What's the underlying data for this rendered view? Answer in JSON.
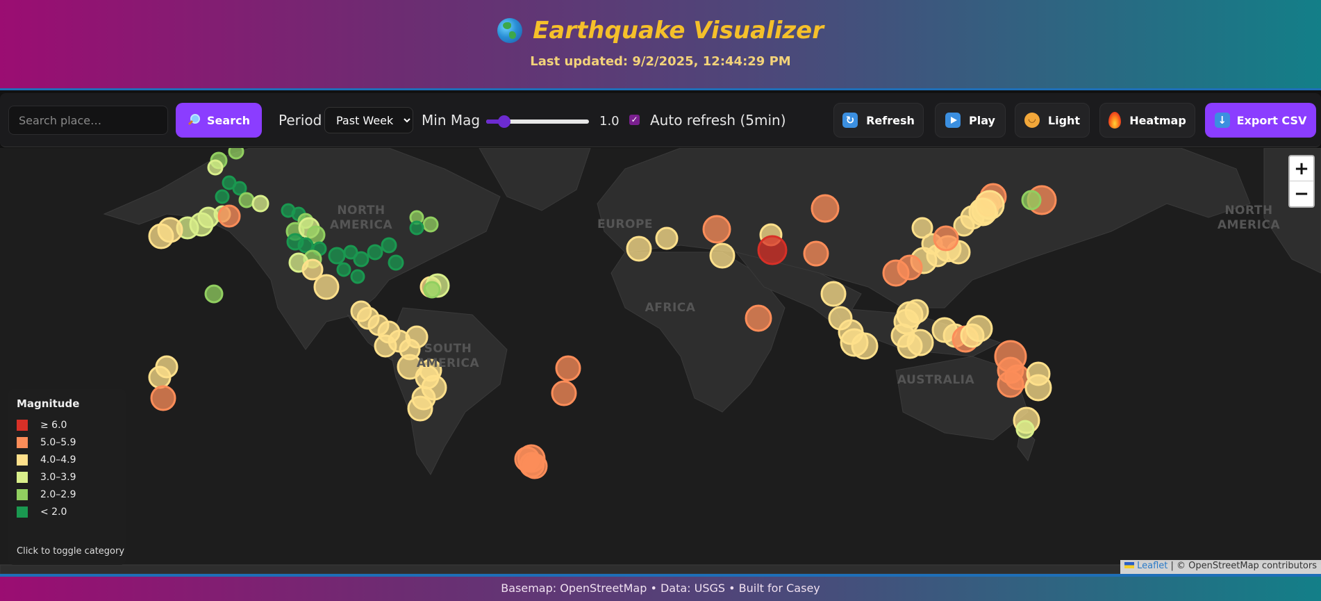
{
  "header": {
    "title": "Earthquake Visualizer",
    "updated": "Last updated: 9/2/2025, 12:44:29 PM"
  },
  "toolbar": {
    "search_placeholder": "Search place…",
    "search_label": "Search",
    "period_label": "Period",
    "period_selected": "Past Week",
    "minmag_label": "Min Mag",
    "minmag_value": "1.0",
    "minmag_level": 1.0,
    "autorefresh_label": "Auto refresh (5min)",
    "autorefresh_checked": true,
    "refresh_label": "Refresh",
    "play_label": "Play",
    "theme_label": "Light",
    "heatmap_label": "Heatmap",
    "export_label": "Export CSV"
  },
  "map": {
    "labels": [
      "NORTH AMERICA",
      "EUROPE",
      "AFRICA",
      "SOUTH AMERICA",
      "AUSTRALIA",
      "NORTH AMERICA"
    ],
    "zoom_in": "+",
    "zoom_out": "−",
    "attribution_link": "Leaflet",
    "attribution_text": "| © OpenStreetMap contributors"
  },
  "legend": {
    "title": "Magnitude",
    "items": [
      {
        "label": "≥ 6.0",
        "color": "#d73027"
      },
      {
        "label": "5.0–5.9",
        "color": "#fc8d59"
      },
      {
        "label": "4.0–4.9",
        "color": "#fee08b"
      },
      {
        "label": "3.0–3.9",
        "color": "#d9ef8b"
      },
      {
        "label": "2.0–2.9",
        "color": "#91cf60"
      },
      {
        "label": "< 2.0",
        "color": "#1a9850"
      }
    ],
    "hint": "Click to toggle category"
  },
  "footer": {
    "text": "Basemap: OpenStreetMap • Data: USGS • Built for Casey"
  }
}
